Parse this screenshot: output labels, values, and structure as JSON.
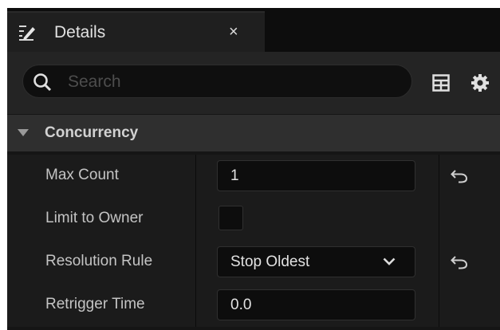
{
  "tab": {
    "title": "Details",
    "close": "×",
    "icon": "details-edit-icon"
  },
  "toolbar": {
    "search_placeholder": "Search",
    "search_value": "",
    "view_options_icon": "table-view-icon",
    "settings_icon": "gear-icon"
  },
  "section": {
    "title": "Concurrency",
    "expanded": true
  },
  "properties": [
    {
      "label": "Max Count",
      "type": "number",
      "value": "1",
      "resettable": true
    },
    {
      "label": "Limit to Owner",
      "type": "checkbox",
      "checked": false,
      "resettable": false
    },
    {
      "label": "Resolution Rule",
      "type": "dropdown",
      "value": "Stop Oldest",
      "resettable": true
    },
    {
      "label": "Retrigger Time",
      "type": "number",
      "value": "0.0",
      "resettable": false
    }
  ],
  "colors": {
    "panel_bg": "#151515",
    "section_header_bg": "#2f2f2f",
    "row_bg": "#1b1b1b",
    "input_bg": "#0d0d0d",
    "text": "#c4c4c4"
  }
}
